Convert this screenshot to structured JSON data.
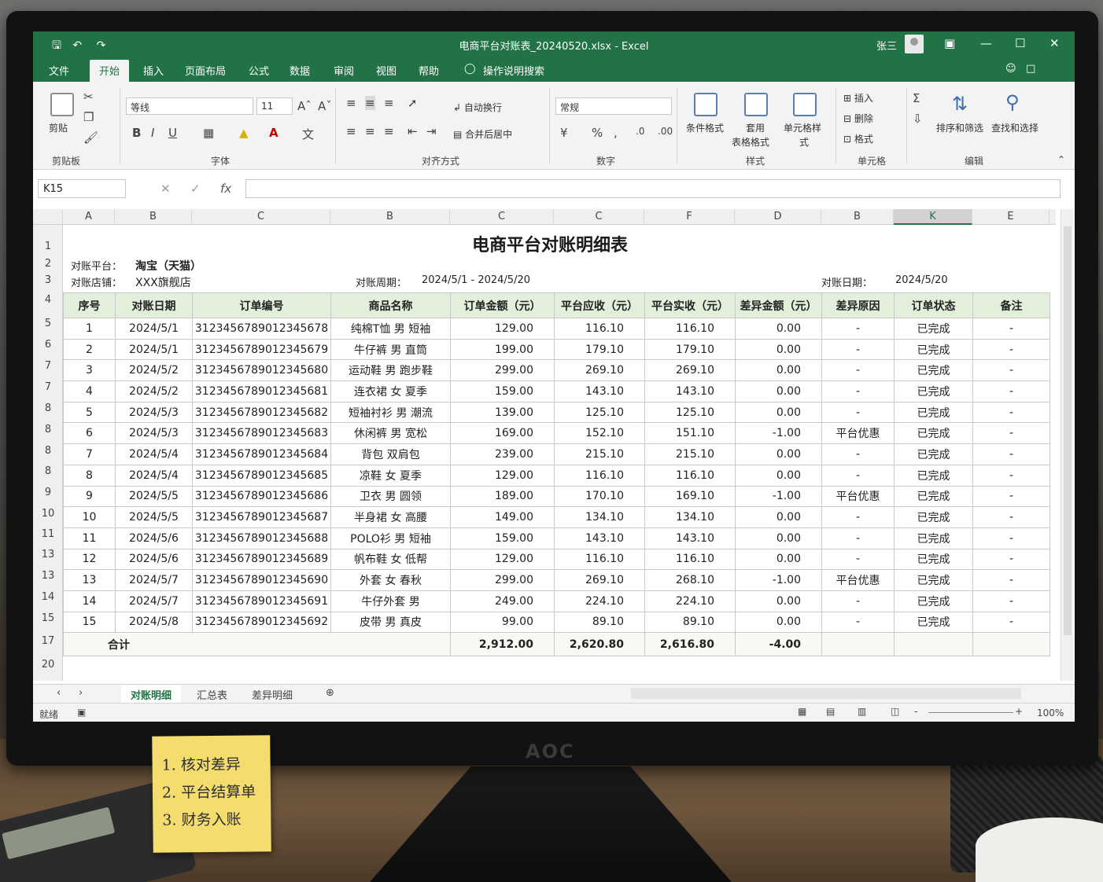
{
  "window": {
    "title": "电商平台对账表_20240520.xlsx - Excel",
    "user": "张三"
  },
  "menu": {
    "tabs": [
      "文件",
      "开始",
      "插入",
      "页面布局",
      "公式",
      "数据",
      "审阅",
      "视图",
      "帮助"
    ],
    "active": "开始",
    "search": "操作说明搜索"
  },
  "ribbon": {
    "paste": "剪贴",
    "clipboard_group": "剪贴板",
    "font_name": "等线",
    "font_size": "11",
    "font_group": "字体",
    "wrap_text": "自动换行",
    "merge_center": "合并后居中",
    "alignment_group": "对齐方式",
    "number_format": "常规",
    "number_group": "数字",
    "cond_format": "条件格式",
    "table_format_1": "套用",
    "table_format_2": "表格格式",
    "cell_style_1": "单元格样",
    "cell_style_2": "式",
    "styles_group": "样式",
    "insert": "插入",
    "delete": "删除",
    "format": "格式",
    "cells_group": "单元格",
    "sort_filter": "排序和筛选",
    "find_select": "查找和选择",
    "editing_group": "编辑"
  },
  "formula_bar": {
    "name_box": "K15",
    "fx": "fx",
    "content": ""
  },
  "columns": [
    "A",
    "B",
    "C",
    "B",
    "C",
    "C",
    "F",
    "D",
    "B",
    "K",
    "E"
  ],
  "selected_column": "K",
  "row_numbers": [
    "1",
    "2",
    "3",
    "4",
    "5",
    "6",
    "7",
    "7",
    "8",
    "8",
    "8",
    "8",
    "9",
    "10",
    "11",
    "13",
    "13",
    "14",
    "15",
    "17",
    "20"
  ],
  "sheet": {
    "title": "电商平台对账明细表",
    "platform_label": "对账平台：",
    "platform_value": "淘宝（天猫）",
    "store_label": "对账店铺：",
    "store_value": "XXX旗舰店",
    "period_label": "对账周期：",
    "period_value": "2024/5/1 - 2024/5/20",
    "date_label": "对账日期：",
    "date_value": "2024/5/20",
    "headers": [
      "序号",
      "对账日期",
      "订单编号",
      "商品名称",
      "订单金额（元）",
      "平台应收（元）",
      "平台实收（元）",
      "差异金额（元）",
      "差异原因",
      "订单状态",
      "备注"
    ],
    "rows": [
      [
        "1",
        "2024/5/1",
        "3123456789012345678",
        "纯棉T恤 男 短袖",
        "129.00",
        "116.10",
        "116.10",
        "0.00",
        "-",
        "已完成",
        "-"
      ],
      [
        "2",
        "2024/5/1",
        "3123456789012345679",
        "牛仔裤 男 直筒",
        "199.00",
        "179.10",
        "179.10",
        "0.00",
        "-",
        "已完成",
        "-"
      ],
      [
        "3",
        "2024/5/2",
        "3123456789012345680",
        "运动鞋 男 跑步鞋",
        "299.00",
        "269.10",
        "269.10",
        "0.00",
        "-",
        "已完成",
        "-"
      ],
      [
        "4",
        "2024/5/2",
        "3123456789012345681",
        "连衣裙 女 夏季",
        "159.00",
        "143.10",
        "143.10",
        "0.00",
        "-",
        "已完成",
        "-"
      ],
      [
        "5",
        "2024/5/3",
        "3123456789012345682",
        "短袖衬衫 男 潮流",
        "139.00",
        "125.10",
        "125.10",
        "0.00",
        "-",
        "已完成",
        "-"
      ],
      [
        "6",
        "2024/5/3",
        "3123456789012345683",
        "休闲裤 男 宽松",
        "169.00",
        "152.10",
        "151.10",
        "-1.00",
        "平台优惠",
        "已完成",
        "-"
      ],
      [
        "7",
        "2024/5/4",
        "3123456789012345684",
        "背包 双肩包",
        "239.00",
        "215.10",
        "215.10",
        "0.00",
        "-",
        "已完成",
        "-"
      ],
      [
        "8",
        "2024/5/4",
        "3123456789012345685",
        "凉鞋 女 夏季",
        "129.00",
        "116.10",
        "116.10",
        "0.00",
        "-",
        "已完成",
        "-"
      ],
      [
        "9",
        "2024/5/5",
        "3123456789012345686",
        "卫衣 男 圆领",
        "189.00",
        "170.10",
        "169.10",
        "-1.00",
        "平台优惠",
        "已完成",
        "-"
      ],
      [
        "10",
        "2024/5/5",
        "3123456789012345687",
        "半身裙 女 高腰",
        "149.00",
        "134.10",
        "134.10",
        "0.00",
        "-",
        "已完成",
        "-"
      ],
      [
        "11",
        "2024/5/6",
        "3123456789012345688",
        "POLO衫 男 短袖",
        "159.00",
        "143.10",
        "143.10",
        "0.00",
        "-",
        "已完成",
        "-"
      ],
      [
        "12",
        "2024/5/6",
        "3123456789012345689",
        "帆布鞋 女 低帮",
        "129.00",
        "116.10",
        "116.10",
        "0.00",
        "-",
        "已完成",
        "-"
      ],
      [
        "13",
        "2024/5/7",
        "3123456789012345690",
        "外套 女 春秋",
        "299.00",
        "269.10",
        "268.10",
        "-1.00",
        "平台优惠",
        "已完成",
        "-"
      ],
      [
        "14",
        "2024/5/7",
        "3123456789012345691",
        "牛仔外套 男",
        "249.00",
        "224.10",
        "224.10",
        "0.00",
        "-",
        "已完成",
        "-"
      ],
      [
        "15",
        "2024/5/8",
        "3123456789012345692",
        "皮带 男 真皮",
        "99.00",
        "89.10",
        "89.10",
        "0.00",
        "-",
        "已完成",
        "-"
      ]
    ],
    "total_label": "合计",
    "total_order": "2,912.00",
    "total_receivable": "2,620.80",
    "total_received": "2,616.80",
    "total_diff": "-4.00"
  },
  "sheet_tabs": [
    "对账明细",
    "汇总表",
    "差异明细"
  ],
  "active_sheet": "对账明细",
  "status": {
    "ready": "就绪",
    "zoom": "100%"
  },
  "monitor_brand": "AOC",
  "sticky_note": [
    "1. 核对差异",
    "2. 平台结算单",
    "3. 财务入账"
  ]
}
